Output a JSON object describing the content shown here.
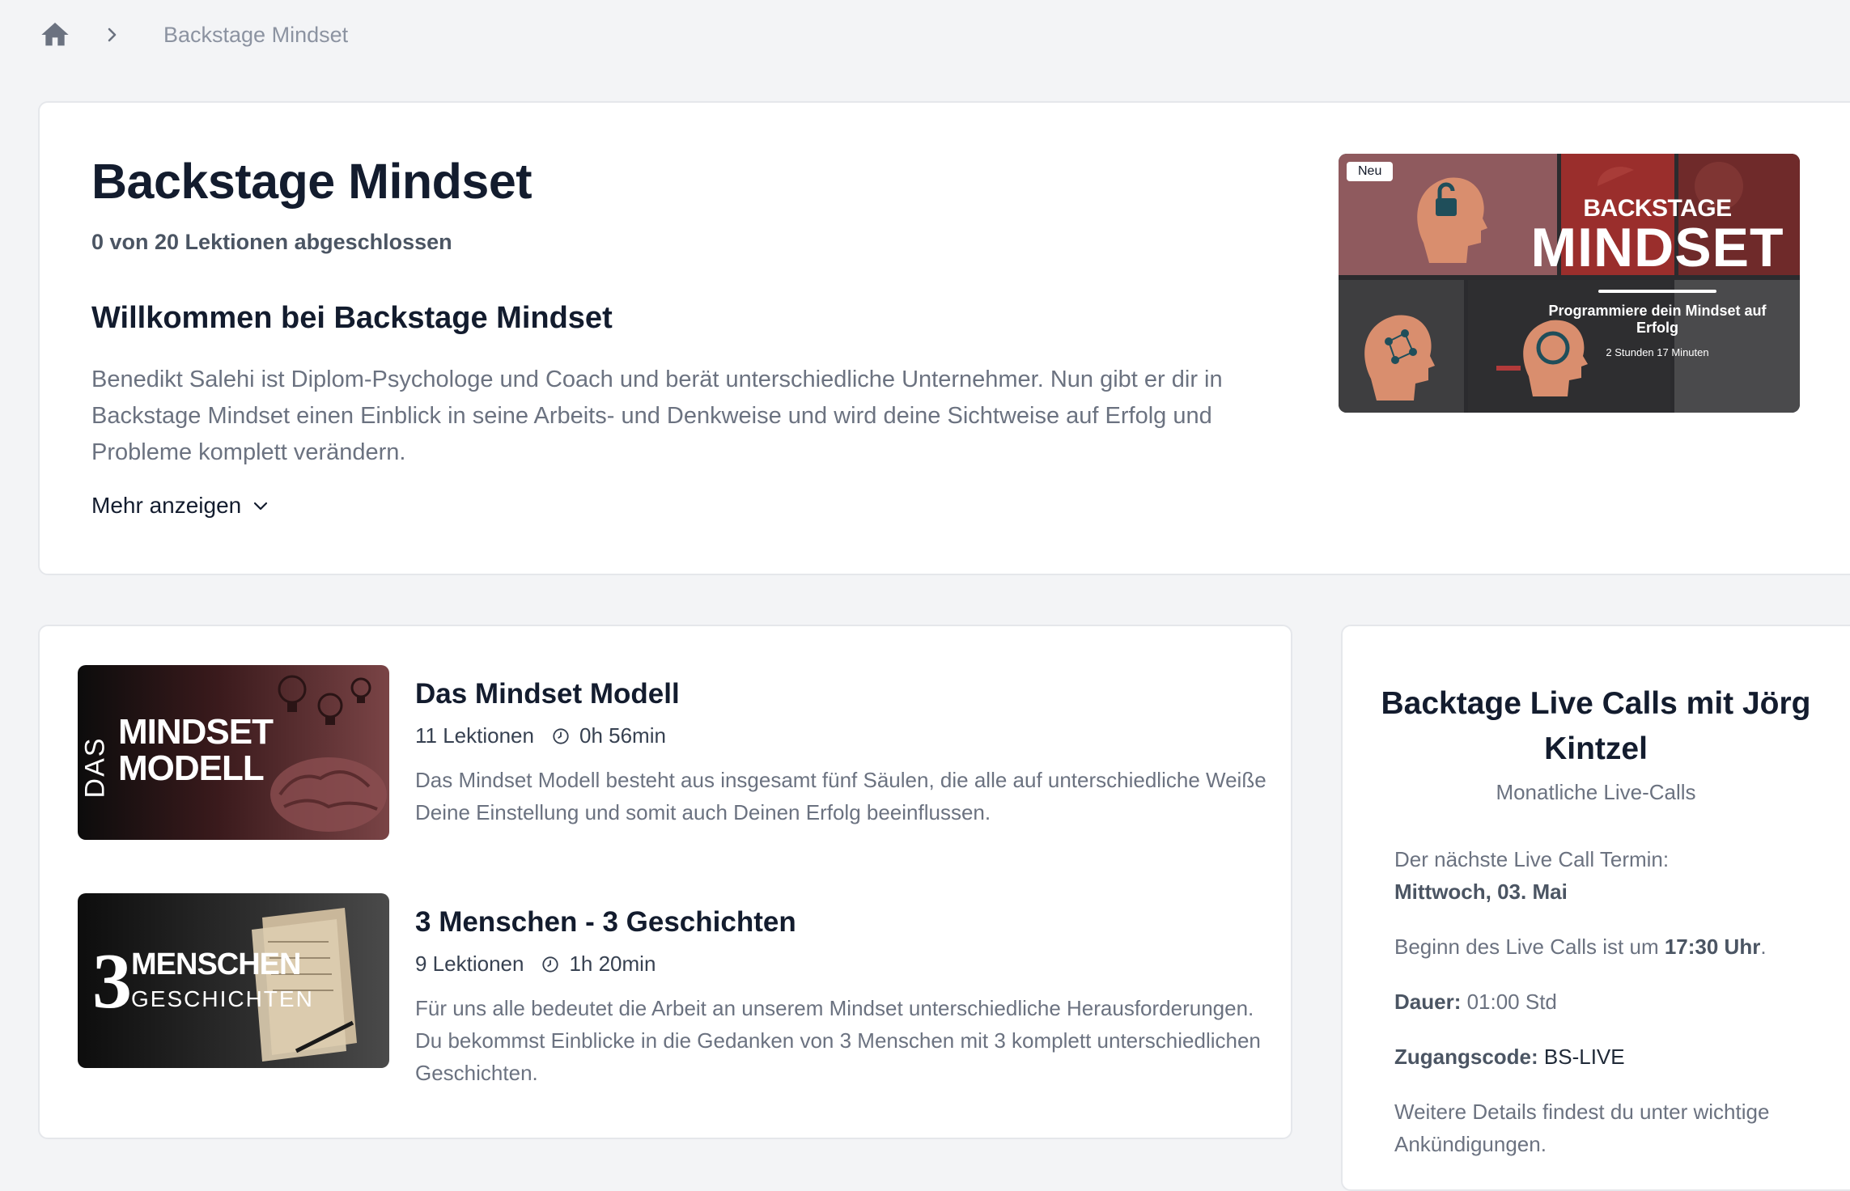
{
  "breadcrumb": {
    "home_icon": "home-icon",
    "separator_icon": "chevron-right-icon",
    "current": "Backstage Mindset"
  },
  "course": {
    "title": "Backstage Mindset",
    "progress": "0 von 20 Lektionen abgeschlossen",
    "welcome_title": "Willkommen bei Backstage Mindset",
    "description": "Benedikt Salehi ist Diplom-Psychologe und Coach und berät unterschiedliche Unternehmer. Nun gibt er dir in Backstage Mindset einen Einblick in seine Arbeits- und Denkweise und wird deine Sichtweise auf Erfolg und Probleme komplett verändern.",
    "more_label": "Mehr anzeigen",
    "image": {
      "badge": "Neu",
      "title_line1": "BACKSTAGE",
      "title_line2": "MINDSET",
      "subtitle": "Programmiere dein Mindset auf Erfolg",
      "duration": "2 Stunden 17 Minuten"
    }
  },
  "modules": [
    {
      "title": "Das Mindset Modell",
      "lessons": "11 Lektionen",
      "duration": "0h 56min",
      "description": "Das Mindset Modell besteht aus insgesamt fünf Säulen, die alle auf unterschiedliche Weiße Deine Einstellung und somit auch Deinen Erfolg beeinflussen.",
      "thumb_word_1": "DAS",
      "thumb_word_2": "MINDSET",
      "thumb_word_3": "MODELL"
    },
    {
      "title": "3 Menschen - 3 Geschichten",
      "lessons": "9 Lektionen",
      "duration": "1h 20min",
      "description": "Für uns alle bedeutet die Arbeit an unserem Mindset unterschiedliche Herausforderungen. Du bekommst Einblicke in die Gedanken von 3 Menschen mit 3 komplett unterschiedlichen Geschichten.",
      "thumb_number": "3",
      "thumb_word_1": "MENSCHEN",
      "thumb_word_2": "GESCHICHTEN"
    }
  ],
  "live_calls": {
    "title": "Backtage Live Calls mit Jörg Kintzel",
    "subtitle": "Monatliche Live-Calls",
    "next_label": "Der nächste Live Call Termin:",
    "next_date": "Mittwoch, 03. Mai",
    "start_prefix": "Beginn des Live Calls ist um ",
    "start_time": "17:30 Uhr",
    "start_suffix": ".",
    "duration_label": "Dauer:",
    "duration_value": " 01:00 Std",
    "code_label": "Zugangscode:",
    "code_value": " BS-LIVE",
    "details": "Weitere Details findest du unter wichtige Ankündigungen."
  },
  "colors": {
    "background": "#f3f4f6",
    "card": "#ffffff",
    "title": "#131c2e",
    "muted": "#6b7280",
    "breadcrumb_icon": "#6b7280"
  }
}
